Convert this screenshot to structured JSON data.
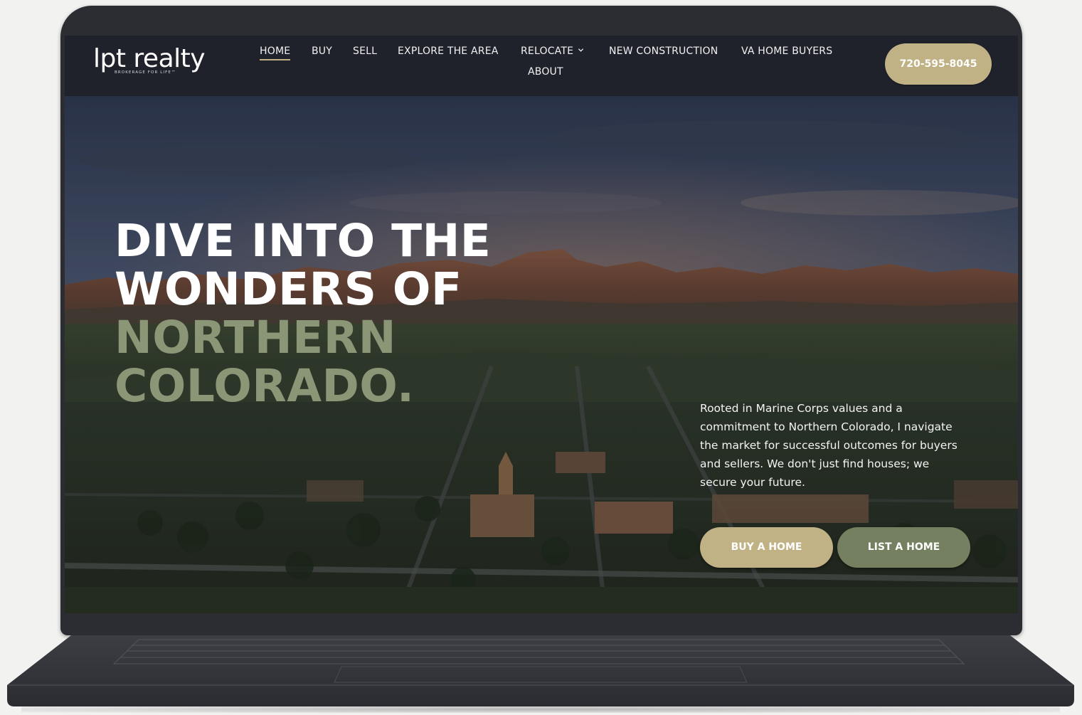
{
  "site": {
    "logo_text": "lpt realty",
    "logo_tagline": "BROKERAGE FOR LIFE™"
  },
  "nav": {
    "items": [
      {
        "label": "HOME"
      },
      {
        "label": "BUY"
      },
      {
        "label": "SELL"
      },
      {
        "label": "EXPLORE THE AREA"
      },
      {
        "label": "RELOCATE"
      },
      {
        "label": "NEW CONSTRUCTION"
      },
      {
        "label": "VA HOME BUYERS"
      },
      {
        "label": "ABOUT"
      }
    ],
    "active": "HOME",
    "phone": "720-595-8045"
  },
  "hero": {
    "title_line1": "DIVE INTO THE",
    "title_line2": "WONDERS OF",
    "title_line3": "NORTHERN",
    "title_line4": "COLORADO.",
    "description": "Rooted in Marine Corps values and a commitment to Northern Colorado, I navigate the market for successful outcomes for buyers and sellers. We don't just find houses; we secure your future.",
    "buy_button": "BUY A HOME",
    "list_button": "LIST A HOME"
  },
  "colors": {
    "header_bg": "#1f222b",
    "accent_gold": "#c1b285",
    "accent_green": "#74805f",
    "title_green": "#8b9676"
  },
  "icons": {
    "relocate_dropdown": "chevron-down-icon"
  }
}
